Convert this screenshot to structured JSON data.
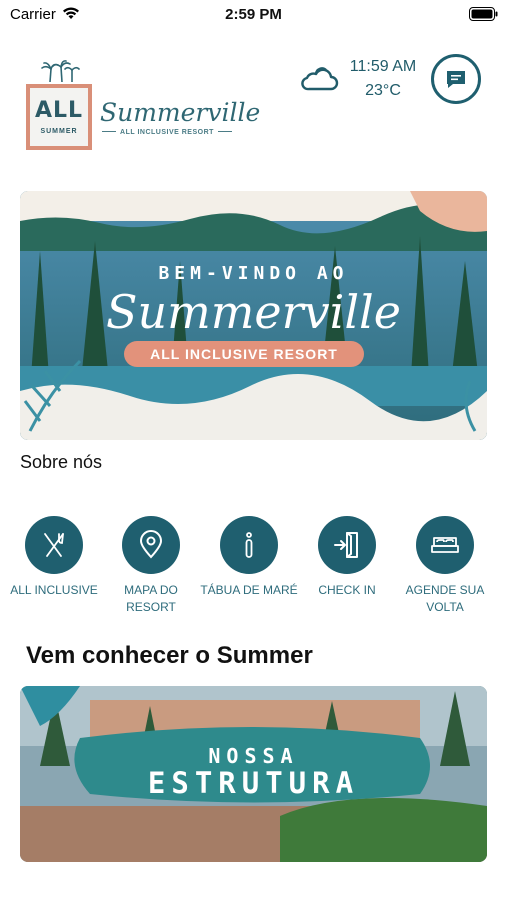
{
  "status_bar": {
    "carrier": "Carrier",
    "time": "2:59 PM"
  },
  "header": {
    "logo_box_text": "ALL",
    "logo_box_sub": "SUMMER",
    "logo_name": "Summerville",
    "logo_sub": "ALL INCLUSIVE RESORT",
    "weather_icon": "cloud-icon",
    "time": "11:59 AM",
    "temperature": "23°C",
    "chat_icon": "chat-icon"
  },
  "hero": {
    "pretitle": "BEM-VINDO AO",
    "title": "Summerville",
    "subtitle": "ALL INCLUSIVE RESORT"
  },
  "about_label": "Sobre nós",
  "actions": [
    {
      "label": "ALL INCLUSIVE",
      "icon": "fork-knife-icon"
    },
    {
      "label": "MAPA DO RESORT",
      "icon": "map-pin-icon"
    },
    {
      "label": "TÁBUA DE MARÉ",
      "icon": "info-icon"
    },
    {
      "label": "CHECK IN",
      "icon": "door-enter-icon"
    },
    {
      "label": "AGENDE SUA VOLTA",
      "icon": "bed-icon"
    }
  ],
  "section_title": "Vem conhecer o Summer",
  "structure_banner": {
    "line1": "NOSSA",
    "line2": "ESTRUTURA"
  },
  "colors": {
    "primary": "#1f5f6f",
    "accent": "#e2927b",
    "label": "#2e6c7c"
  }
}
